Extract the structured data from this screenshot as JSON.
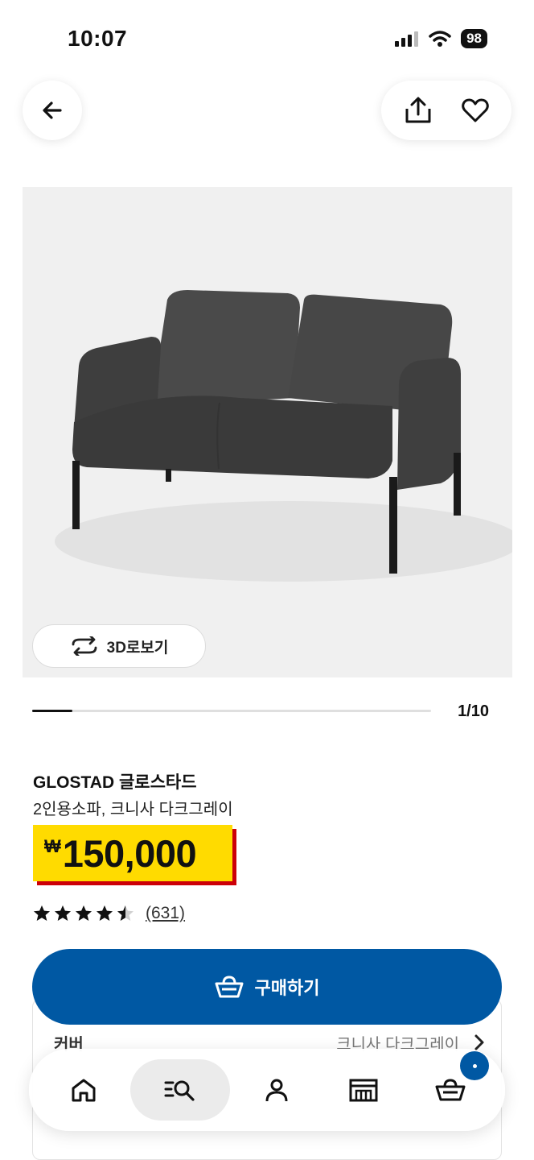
{
  "status_bar": {
    "time": "10:07",
    "battery": "98"
  },
  "top_bar": {
    "back_icon": "arrow-left-icon",
    "share_icon": "share-icon",
    "wishlist_icon": "heart-icon"
  },
  "gallery": {
    "view_3d_label": "3D로보기",
    "page_counter": "1/10",
    "progress_fraction": 0.1
  },
  "product": {
    "name": "GLOSTAD 글로스타드",
    "description": "2인용소파, 크니사 다크그레이",
    "currency": "₩",
    "price": "150,000",
    "rating": 4.5,
    "review_count": "(631)"
  },
  "buy": {
    "label": "구매하기",
    "icon": "basket-icon"
  },
  "options": {
    "cover_label": "커버",
    "cover_value": "크니사 다크그레이"
  },
  "nav": {
    "items": [
      "home-icon",
      "search-list-icon",
      "profile-icon",
      "store-icon",
      "cart-icon"
    ],
    "active": 1
  },
  "colors": {
    "brand_blue": "#0058a3",
    "price_yellow": "#ffdb00",
    "price_shadow": "#cc0008"
  }
}
